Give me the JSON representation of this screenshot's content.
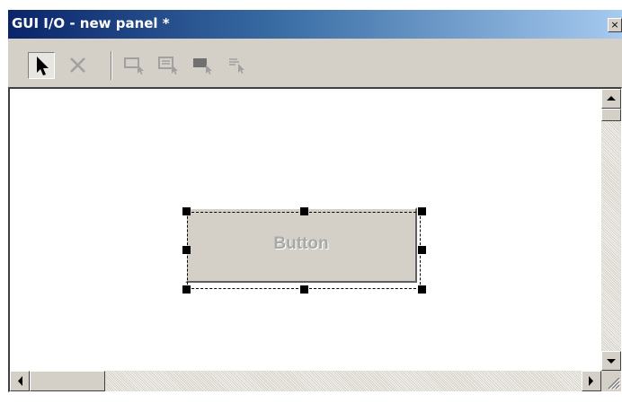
{
  "window": {
    "title": "GUI I/O - new panel *",
    "close_glyph": "×"
  },
  "toolbar": {
    "tools": [
      {
        "name": "select-pointer-icon",
        "pressed": true
      },
      {
        "name": "delete-x-icon",
        "pressed": false
      },
      {
        "name": "add-button-widget-icon",
        "pressed": false
      },
      {
        "name": "add-input-widget-icon",
        "pressed": false
      },
      {
        "name": "add-filled-widget-icon",
        "pressed": false
      },
      {
        "name": "add-label-widget-icon",
        "pressed": false
      }
    ]
  },
  "canvas": {
    "widget": {
      "type": "button",
      "label": "Button",
      "selected": true
    }
  },
  "colors": {
    "title_start": "#0a246a",
    "title_end": "#a6caf0",
    "face": "#d4d0c8",
    "widget_text_disabled": "#a8a8a8"
  }
}
